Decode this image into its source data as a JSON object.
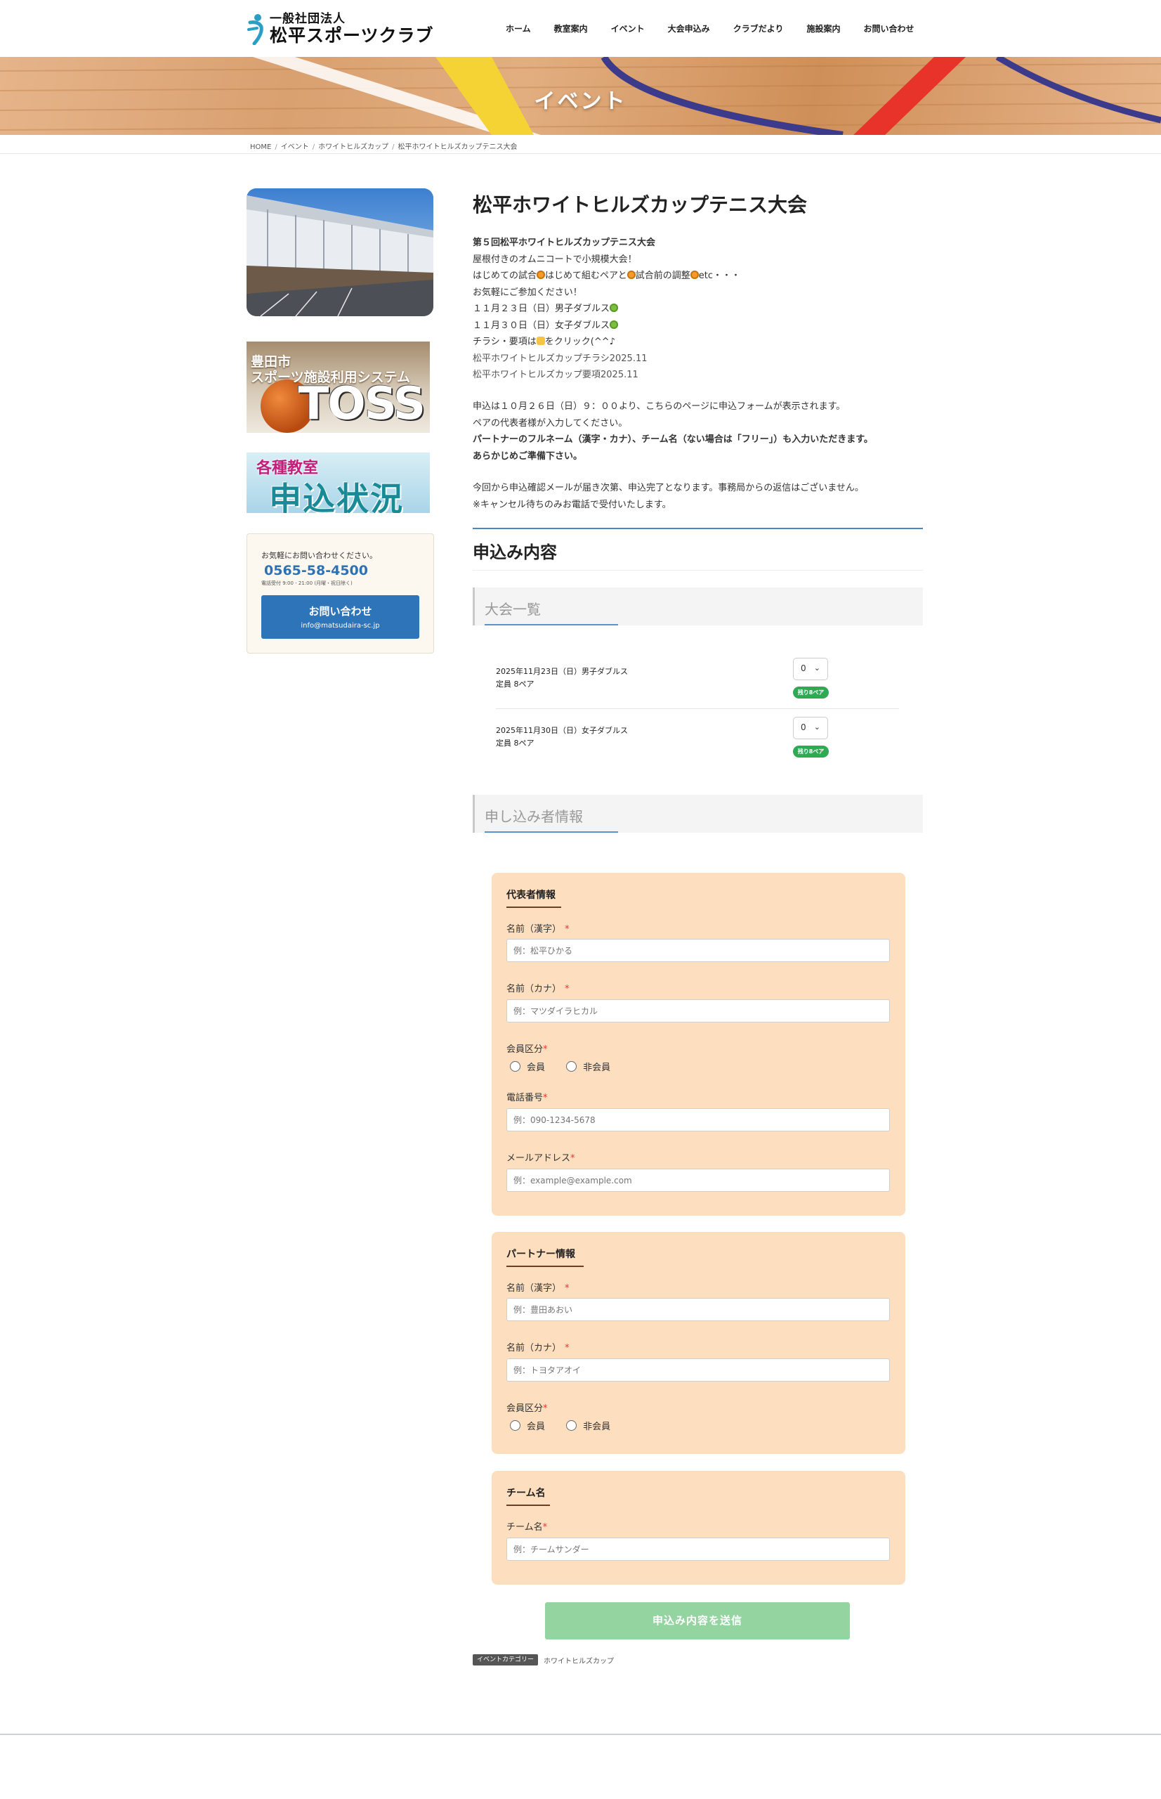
{
  "header": {
    "logo_sub": "一般社団法人",
    "logo_main": "松平スポーツクラブ",
    "nav": [
      "ホーム",
      "教室案内",
      "イベント",
      "大会申込み",
      "クラブだより",
      "施設案内",
      "お問い合わせ"
    ]
  },
  "hero": {
    "title": "イベント"
  },
  "breadcrumb": [
    "HOME",
    "イベント",
    "ホワイトヒルズカップ",
    "松平ホワイトヒルズカップテニス大会"
  ],
  "sidebar": {
    "toss_line1": "豊田市",
    "toss_line2": "スポーツ施設利用システム",
    "toss_big": "TOSS",
    "kyoushitsu_line1": "各種教室",
    "kyoushitsu_line2": "申込状況",
    "contact": {
      "text": "お気軽にお問い合わせください。",
      "tel": "0565-58-4500",
      "hours": "電話受付 9:00 - 21:00 (月曜・祝日除く)",
      "button_label": "お問い合わせ",
      "button_email": "info@matsudaira-sc.jp"
    }
  },
  "main": {
    "title": "松平ホワイトヒルズカップテニス大会",
    "intro": {
      "heading": "第５回松平ホワイトヒルズカップテニス大会",
      "l2": "屋根付きのオムニコートで小規模大会！",
      "l3a": "はじめての試合",
      "l3b": "はじめて組むペアと",
      "l3c": "試合前の調整",
      "l3d": "etc・・・",
      "l4": "お気軽にご参加ください！",
      "l5": "１１月２３日（日）男子ダブルス",
      "l6": "１１月３０日（日）女子ダブルス",
      "l7a": "チラシ・要項は",
      "l7b": "をクリック(^^♪",
      "link1": "松平ホワイトヒルズカップチラシ2025.11",
      "link2": "松平ホワイトヒルズカップ要項2025.11"
    },
    "p2": {
      "l1": "申込は１０月２６日（日）９：００より、こちらのページに申込フォームが表示されます。",
      "l2": "ペアの代表者様が入力してください。",
      "l3": "パートナーのフルネーム（漢字・カナ）、チーム名（ない場合は「フリー」）も入力いただきます。",
      "l4": "あらかじめご準備下さい。"
    },
    "p3": {
      "l1": "今回から申込確認メールが届き次第、申込完了となります。事務局からの返信はございません。",
      "l2": "※キャンセル待ちのみお電話で受付いたします。"
    },
    "section_title": "申込み内容",
    "events_heading": "大会一覧",
    "events": [
      {
        "line1": "2025年11月23日（日）男子ダブルス",
        "line2": "定員 8ペア",
        "qty": "0",
        "badge": "残り8ペア"
      },
      {
        "line1": "2025年11月30日（日）女子ダブルス",
        "line2": "定員 8ペア",
        "qty": "0",
        "badge": "残り8ペア"
      }
    ],
    "applicant_heading": "申し込み者情報",
    "representative": {
      "title": "代表者情報",
      "name_kanji_label": "名前（漢字）",
      "name_kanji_placeholder": "例：松平ひかる",
      "name_kana_label": "名前（カナ）",
      "name_kana_placeholder": "例：マツダイラヒカル",
      "member_label": "会員区分",
      "member_opt1": "会員",
      "member_opt2": "非会員",
      "phone_label": "電話番号",
      "phone_placeholder": "例：090-1234-5678",
      "email_label": "メールアドレス",
      "email_placeholder": "例：example@example.com"
    },
    "partner": {
      "title": "パートナー情報",
      "name_kanji_label": "名前（漢字）",
      "name_kanji_placeholder": "例：豊田あおい",
      "name_kana_label": "名前（カナ）",
      "name_kana_placeholder": "例：トヨタアオイ",
      "member_label": "会員区分",
      "member_opt1": "会員",
      "member_opt2": "非会員"
    },
    "team": {
      "title": "チーム名",
      "label": "チーム名",
      "placeholder": "例：チームサンダー"
    },
    "required_mark": "*",
    "submit_label": "申込み内容を送信",
    "category_tag": "イベントカテゴリー",
    "category_link": "ホワイトヒルズカップ"
  },
  "colors": {
    "accent_blue": "#2e74b9",
    "form_bg": "#fddfbf",
    "submit_green": "#93d4a0",
    "badge_green": "#2eaa55"
  }
}
